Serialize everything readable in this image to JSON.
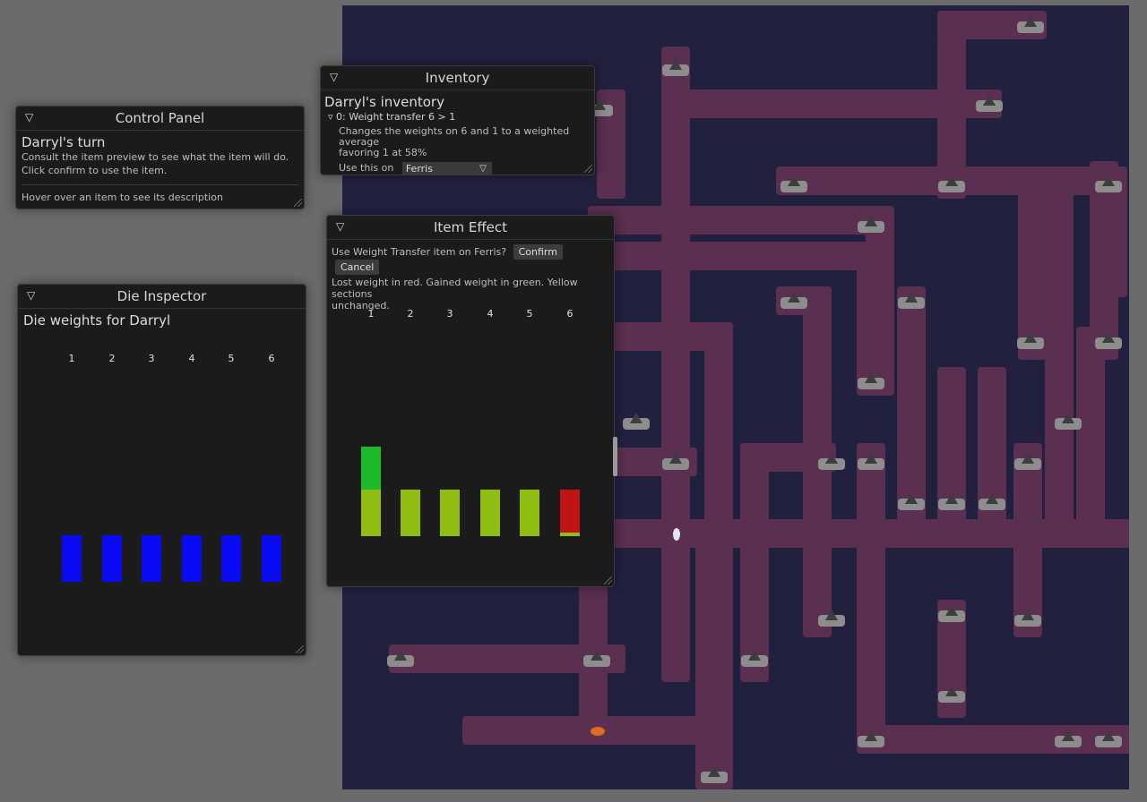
{
  "control_panel": {
    "title": "Control Panel",
    "turn": "Darryl's turn",
    "line1": "Consult the item preview to see what the item will do.",
    "line2": "Click confirm to use the item.",
    "hint": "Hover over an item to see its description"
  },
  "inventory": {
    "title": "Inventory",
    "heading": "Darryl's inventory",
    "item_title": "0: Weight transfer 6 > 1",
    "desc1": "Changes the weights on 6 and 1 to a weighted average",
    "desc2": "favoring 1 at 58%",
    "use_on_label": "Use this on",
    "target": "Ferris"
  },
  "item_effect": {
    "title": "Item Effect",
    "question": "Use Weight Transfer item on Ferris?",
    "confirm": "Confirm",
    "cancel": "Cancel",
    "legend1": "Lost weight in red. Gained weight in green. Yellow sections",
    "legend2": "unchanged.",
    "chart_data": {
      "type": "bar",
      "categories": [
        "1",
        "2",
        "3",
        "4",
        "5",
        "6"
      ],
      "series": [
        {
          "name": "unchanged",
          "color": "#8fbd12",
          "values": [
            1.0,
            1.0,
            1.0,
            1.0,
            1.0,
            0.08
          ]
        },
        {
          "name": "gained",
          "color": "#1dbb2b",
          "values": [
            0.92,
            0,
            0,
            0,
            0,
            0
          ]
        },
        {
          "name": "lost",
          "color": "#c01414",
          "values": [
            0,
            0,
            0,
            0,
            0,
            0.92
          ]
        }
      ],
      "ylim": [
        0,
        4.0
      ]
    }
  },
  "die_inspector": {
    "title": "Die Inspector",
    "heading": "Die weights for Darryl",
    "chart_data": {
      "type": "bar",
      "categories": [
        "1",
        "2",
        "3",
        "4",
        "5",
        "6"
      ],
      "values": [
        1,
        1,
        1,
        1,
        1,
        1
      ],
      "color": "#0a0af5",
      "ylim": [
        0,
        4.5
      ]
    }
  },
  "colors": {
    "board": "#22203f",
    "path": "#5a2f4f",
    "stone": "#8d8d8d"
  }
}
